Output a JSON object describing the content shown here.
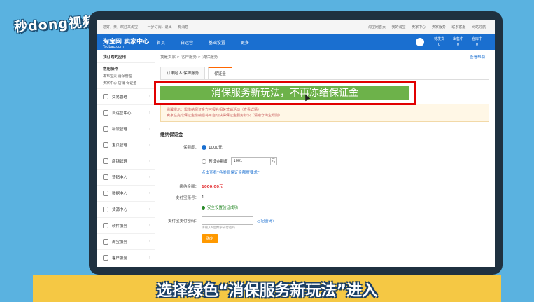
{
  "watermark": "秒dong视频",
  "topstrip": {
    "left": [
      "您好，亲，欢迎来淘宝！",
      "一步订阅，退出",
      "有消息"
    ],
    "right": [
      "淘宝网首页",
      "我的淘宝",
      "卖家中心",
      "卖家服务",
      "联系客服",
      "网站导航"
    ]
  },
  "header": {
    "brand": "淘宝网 卖家中心",
    "brand_sub": "Taobao.com",
    "nav": [
      "首页",
      "自运营",
      "基础设置",
      "更多"
    ],
    "stats": [
      {
        "label": "待发货",
        "value": "0"
      },
      {
        "label": "出售中",
        "value": "0"
      },
      {
        "label": "仓库中",
        "value": "0"
      }
    ]
  },
  "sidebar": {
    "head": "我订购的应用",
    "sub": "常用操作",
    "links": [
      "发布宝贝",
      "消保管理",
      "卖家中心",
      "店铺",
      "保证金"
    ],
    "items": [
      "交易管理",
      "自运营中心",
      "物流管理",
      "宝贝管理",
      "店铺管理",
      "营销中心",
      "数据中心",
      "货源中心",
      "软件服务",
      "淘宝服务",
      "客户服务"
    ]
  },
  "main": {
    "crumbs": "我是卖家 > 客户服务 > 消保服务",
    "crumb_action": "查看帮助",
    "tabs": [
      "订单险 & 保障服务",
      "保证金"
    ],
    "notice1": "温馨提示：需缴纳保证金方可报名相关营销活动（查看详情）",
    "notice2": "卖家在完成保证金缴纳后将可自动获得保证金服务标识（请遵守淘宝规则）",
    "section": "缴纳保证金",
    "form": {
      "amount_label": "保额度：",
      "opt1": "1000元",
      "opt2": "预设金额度",
      "input_value": "1001",
      "unit": "元",
      "link": "点击查看“各类目保证金额度要求”",
      "pay_label": "缴纳金额：",
      "pay_value": "1000.00元",
      "account_label": "支付宝账号：",
      "account_value": "1",
      "ok_text": "安全设置验证成功！",
      "pwd_label": "支付宝支付密码：",
      "forgot": "忘记密码？",
      "hint": "请输入6位数字支付密码",
      "submit": "确定"
    }
  },
  "banner": {
    "text": "消保服务新玩法，不再冻结保证金"
  },
  "subtitle": "选择绿色“消保服务新玩法”进入"
}
